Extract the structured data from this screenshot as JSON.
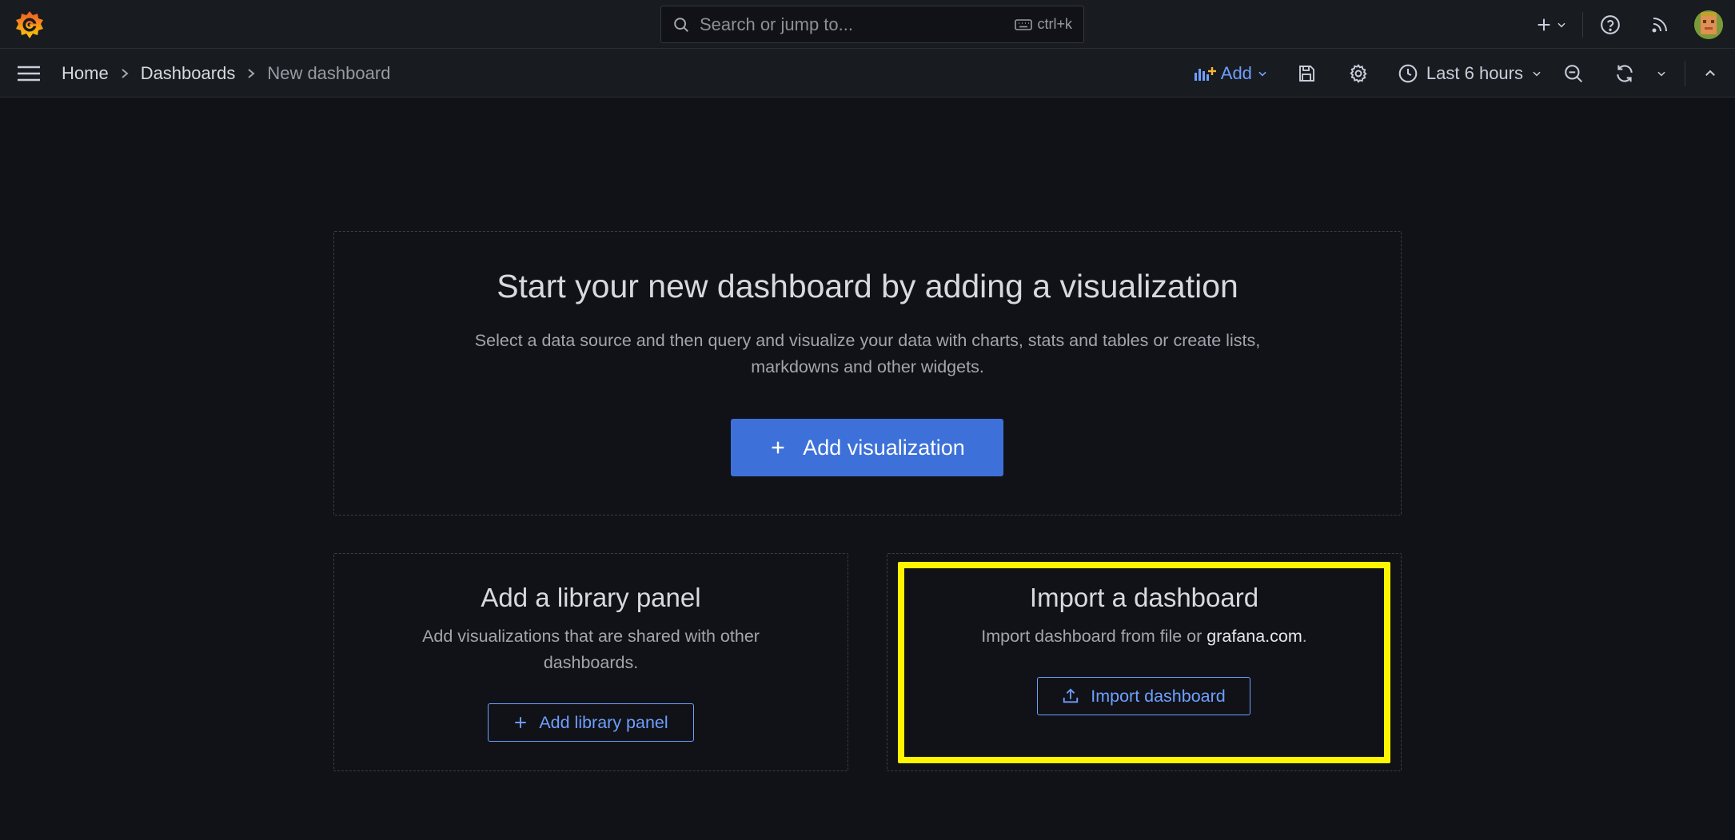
{
  "topbar": {
    "search_placeholder": "Search or jump to...",
    "search_shortcut": "ctrl+k"
  },
  "breadcrumb": {
    "home": "Home",
    "dashboards": "Dashboards",
    "current": "New dashboard"
  },
  "toolbar": {
    "add_label": "Add",
    "time_range": "Last 6 hours"
  },
  "main": {
    "title": "Start your new dashboard by adding a visualization",
    "description": "Select a data source and then query and visualize your data with charts, stats and tables or create lists, markdowns and other widgets.",
    "add_visualization_label": "Add visualization"
  },
  "library": {
    "title": "Add a library panel",
    "description": "Add visualizations that are shared with other dashboards.",
    "button_label": "Add library panel"
  },
  "import": {
    "title": "Import a dashboard",
    "description_prefix": "Import dashboard from file or ",
    "description_link": "grafana.com",
    "description_suffix": ".",
    "button_label": "Import dashboard"
  },
  "colors": {
    "background": "#111217",
    "bar": "#181b1f",
    "primary": "#3d71d9",
    "link": "#6e9fff",
    "highlight": "#fff500",
    "logo_orange": "#f46800"
  },
  "icons": [
    "grafana-logo",
    "search-icon",
    "keyboard-icon",
    "plus-icon",
    "chevron-down-icon",
    "help-icon",
    "rss-icon",
    "avatar",
    "hamburger-icon",
    "chevron-right-icon",
    "panel-add-icon",
    "save-icon",
    "gear-icon",
    "clock-icon",
    "zoom-out-icon",
    "refresh-icon",
    "chevron-up-icon",
    "upload-icon"
  ]
}
